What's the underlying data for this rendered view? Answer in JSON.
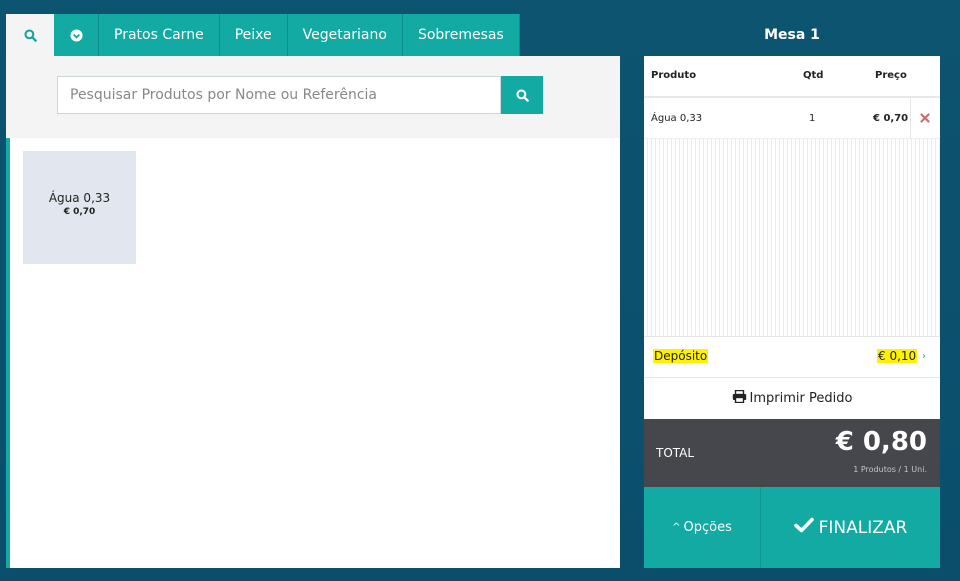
{
  "tabs": [
    {
      "label": "Pratos Carne"
    },
    {
      "label": "Peixe"
    },
    {
      "label": "Vegetariano"
    },
    {
      "label": "Sobremesas"
    }
  ],
  "search": {
    "placeholder": "Pesquisar Produtos por Nome ou Referência"
  },
  "products": [
    {
      "name": "Água 0,33",
      "price": "€ 0,70"
    }
  ],
  "order": {
    "title": "Mesa 1",
    "columns": {
      "product": "Produto",
      "qty": "Qtd",
      "price": "Preço"
    },
    "items": [
      {
        "product": "Água 0,33",
        "qty": "1",
        "price": "€ 0,70"
      }
    ],
    "deposit": {
      "label": "Depósito",
      "value": "€ 0,10"
    },
    "print_label": "Imprimir Pedido",
    "total": {
      "label": "TOTAL",
      "value": "€ 0,80",
      "summary": "1 Produtos / 1 Uni."
    },
    "options_label": "Opções",
    "finalize_label": "FINALIZAR"
  },
  "colors": {
    "accent": "#12aaa3",
    "background": "#0d5470",
    "total_bg": "#46464d",
    "highlight": "#fff200"
  },
  "icons": [
    "search-icon",
    "chevron-down-circle-icon",
    "remove-icon",
    "chevron-right-icon",
    "printer-icon",
    "chevron-up-icon",
    "check-icon"
  ]
}
